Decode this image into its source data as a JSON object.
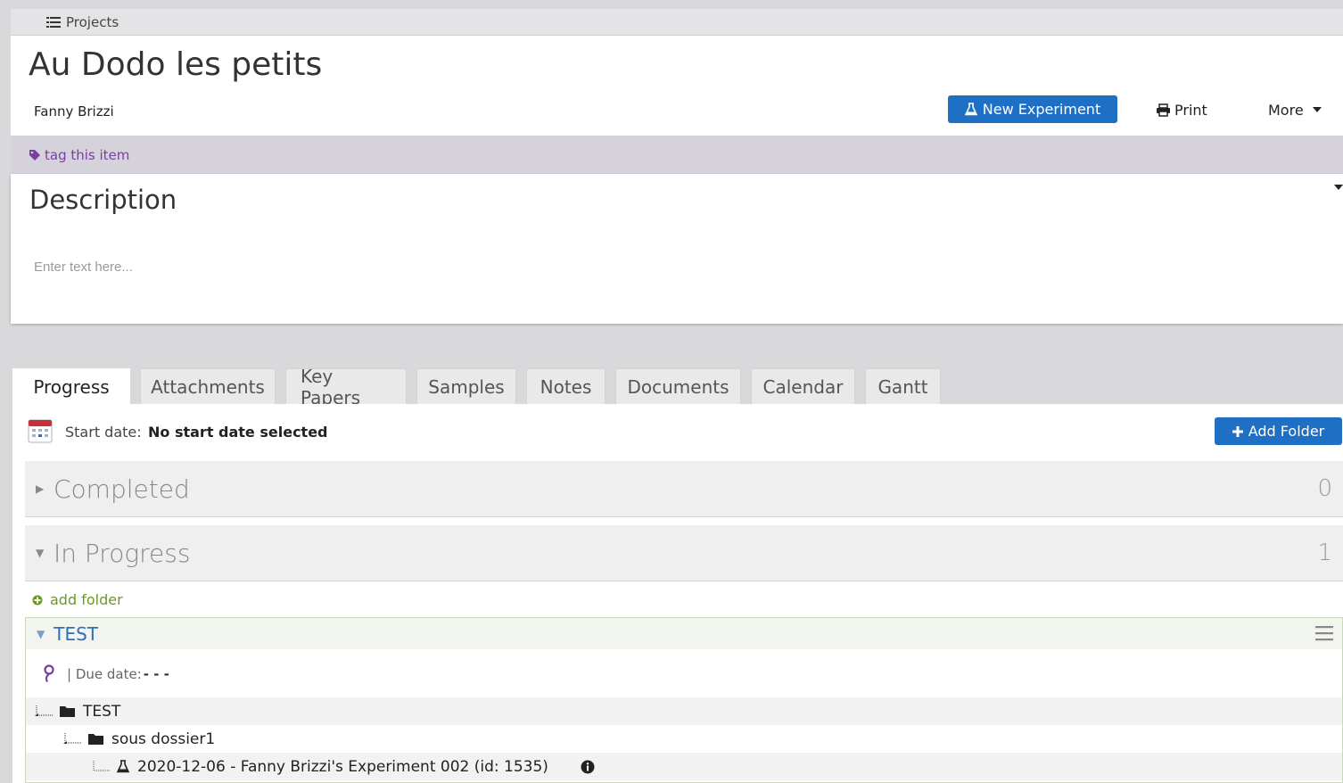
{
  "breadcrumb": {
    "label": "Projects"
  },
  "project": {
    "title": "Au Dodo les petits",
    "owner": "Fanny Brizzi"
  },
  "toolbar": {
    "new_experiment": "New Experiment",
    "print": "Print",
    "more": "More"
  },
  "tags": {
    "placeholder": "tag this item"
  },
  "description": {
    "title": "Description",
    "placeholder": "Enter text here..."
  },
  "tabs": [
    {
      "label": "Progress",
      "active": true
    },
    {
      "label": "Attachments"
    },
    {
      "label": "Key Papers"
    },
    {
      "label": "Samples"
    },
    {
      "label": "Notes"
    },
    {
      "label": "Documents"
    },
    {
      "label": "Calendar"
    },
    {
      "label": "Gantt"
    }
  ],
  "progress": {
    "start_label": "Start date:",
    "start_value": "No start date selected",
    "add_folder_button": "Add Folder",
    "sections": {
      "completed": {
        "label": "Completed",
        "count": "0"
      },
      "in_progress": {
        "label": "In Progress",
        "count": "1"
      }
    },
    "add_folder_link": "add folder",
    "folder": {
      "name": "TEST",
      "due_label": "| Due date:",
      "due_value": "- - -",
      "tree": [
        {
          "label": "TEST",
          "type": "folder",
          "level": 0
        },
        {
          "label": "sous dossier1",
          "type": "folder",
          "level": 1
        },
        {
          "label": "2020-12-06 - Fanny Brizzi's Experiment 002 (id: 1535)",
          "type": "experiment",
          "level": 2
        }
      ]
    }
  },
  "colors": {
    "primary_button": "#1f6fc4",
    "tag_text": "#7a3ea0",
    "add_folder_green": "#6a9a1f",
    "folder_name_blue": "#2f6fb8"
  },
  "icons": {
    "breadcrumb": "list-icon",
    "new_experiment": "flask-icon",
    "print": "printer-icon",
    "more": "caret-down-icon",
    "tag": "tag-icon",
    "calendar": "calendar-icon",
    "add": "plus-icon",
    "add_folder_link": "plus-circle-icon",
    "folder_menu": "hamburger-icon",
    "owner_symbol": "gender-icon",
    "folder": "folder-icon",
    "experiment": "flask-icon",
    "info": "info-icon"
  }
}
